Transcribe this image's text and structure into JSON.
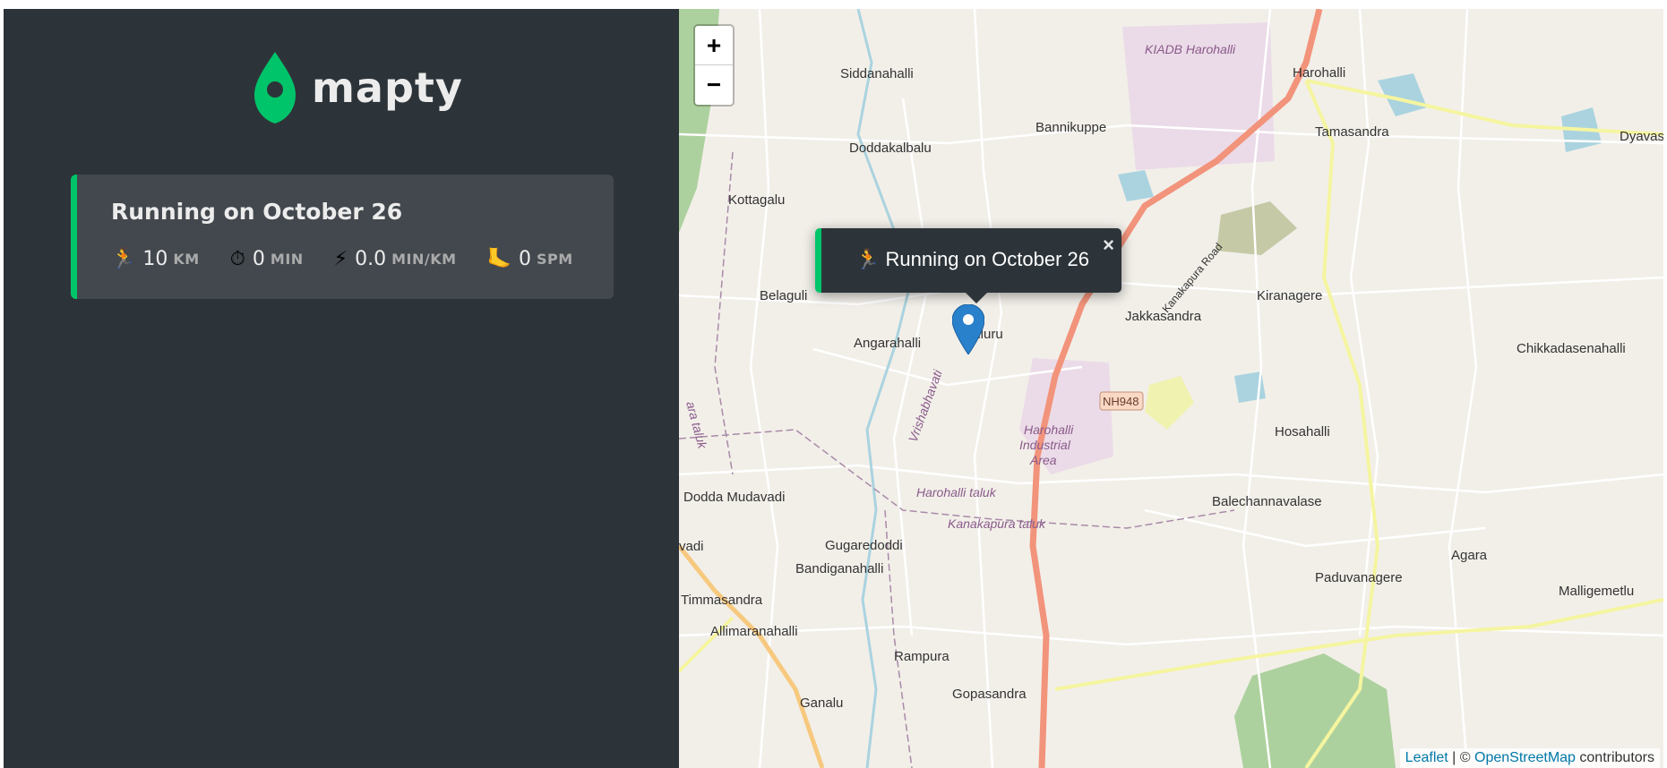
{
  "app": {
    "logo_text": "mapty",
    "brand_color": "#00c46a"
  },
  "workouts": [
    {
      "title": "Running on October 26",
      "type": "running",
      "details": [
        {
          "icon": "runner-icon",
          "glyph": "🏃",
          "value": "10",
          "unit": "km"
        },
        {
          "icon": "stopwatch-icon",
          "glyph": "⏱",
          "value": "0",
          "unit": "min"
        },
        {
          "icon": "lightning-icon",
          "glyph": "⚡",
          "value": "0.0",
          "unit": "min/km"
        },
        {
          "icon": "foot-icon",
          "glyph": "🦶",
          "value": "0",
          "unit": "spm"
        }
      ]
    }
  ],
  "map": {
    "zoom_in": "+",
    "zoom_out": "−",
    "popup": {
      "icon": "🏃",
      "text": "Running on October 26",
      "close": "×"
    },
    "attribution": {
      "leaflet": "Leaflet",
      "separator": " | © ",
      "osm": "OpenStreetMap",
      "suffix": " contributors"
    },
    "labels": {
      "siddanahalli": "Siddanahalli",
      "kiadb": "KIADB Harohalli",
      "harohalli": "Harohalli",
      "bannikuppe": "Bannikuppe",
      "tamasandra": "Tamasandra",
      "dyavasa": "Dyavasa",
      "doddakalbalu": "Doddakalbalu",
      "kottagalu": "Kottagalu",
      "kanakapura_road": "Kanakapura Road",
      "belaguli": "Belaguli",
      "kiranagere": "Kiranagere",
      "jakkasandra": "Jakkasandra",
      "angarahalli": "Angarahalli",
      "chiluru": "hiluru",
      "chikkadasenahalli": "Chikkadasenahalli",
      "nh948": "NH948",
      "harohalli_industrial_1": "Harohalli",
      "harohalli_industrial_2": "Industrial",
      "harohalli_industrial_3": "Area",
      "hosahalli": "Hosahalli",
      "vrishabhavathi": "Vrishabhavati",
      "dodda_mudavadi": "Dodda Mudavadi",
      "harohalli_taluk": "Harohalli taluk",
      "kanakapura_taluk": "Kanakapura taluk",
      "balechannavalase": "Balechannavalase",
      "vadi": "vadi",
      "gugaredoddi": "Gugaredoddi",
      "bandiganahalli": "Bandiganahalli",
      "agara": "Agara",
      "paduvanagere": "Paduvanagere",
      "malligemetlu": "Malligemetlu",
      "timmasandra": "Timmasandra",
      "allimaranahalli": "Allimaranahalli",
      "rampura": "Rampura",
      "gopasandra": "Gopasandra",
      "ganalu": "Ganalu",
      "ara_taluk": "ara taluk"
    }
  }
}
